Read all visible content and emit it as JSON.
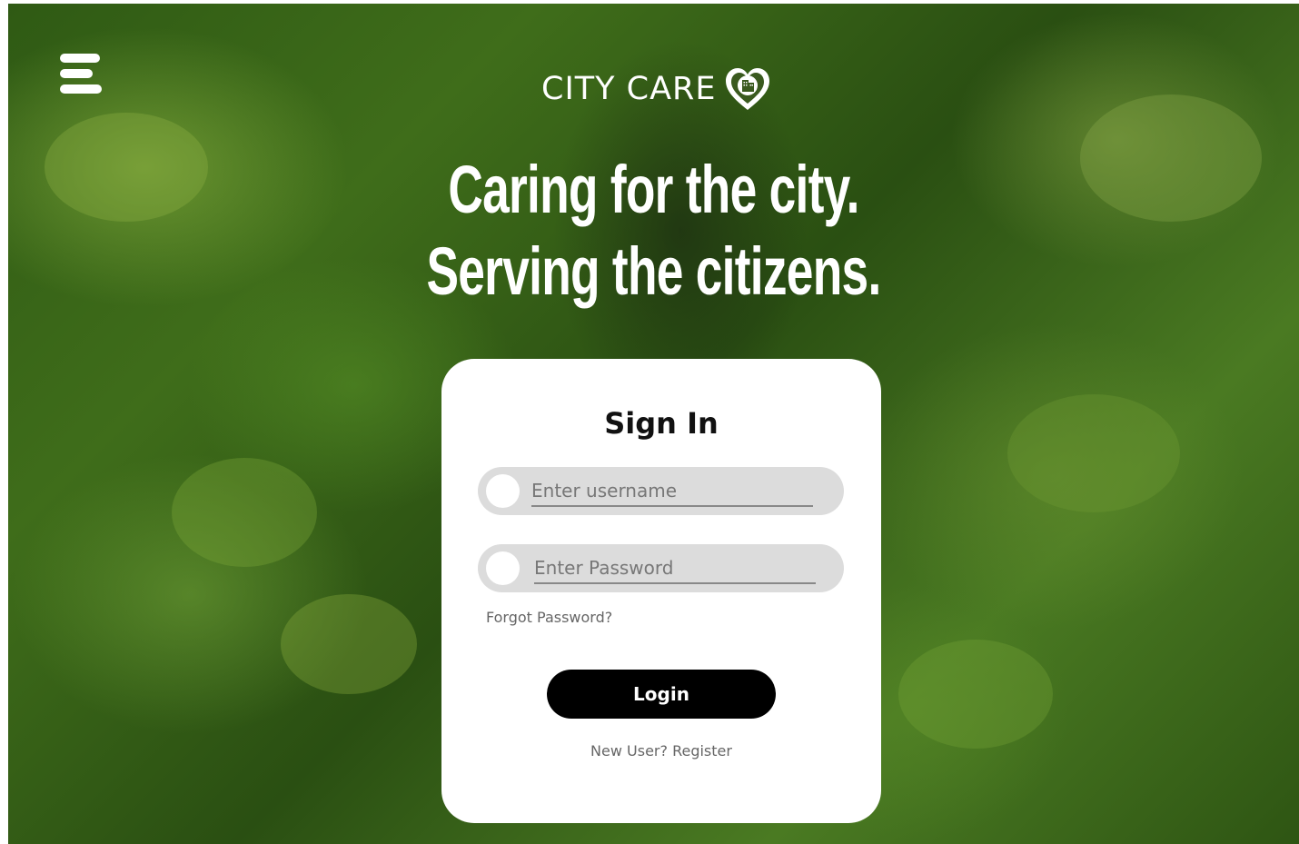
{
  "header": {
    "menu_icon": "hamburger-menu-icon",
    "logo_text": "CITY CARE",
    "logo_icon": "heart-building-icon"
  },
  "hero": {
    "line1": "Caring for the city.",
    "line2": "Serving the citizens."
  },
  "signin": {
    "title": "Sign In",
    "username_placeholder": "Enter username",
    "password_placeholder": "Enter Password",
    "forgot_label": "Forgot Password?",
    "login_label": "Login",
    "register_label": "New User? Register"
  },
  "colors": {
    "card_bg": "#ffffff",
    "field_bg": "#dcdcdc",
    "button_bg": "#000000",
    "text_light": "#ffffff"
  }
}
